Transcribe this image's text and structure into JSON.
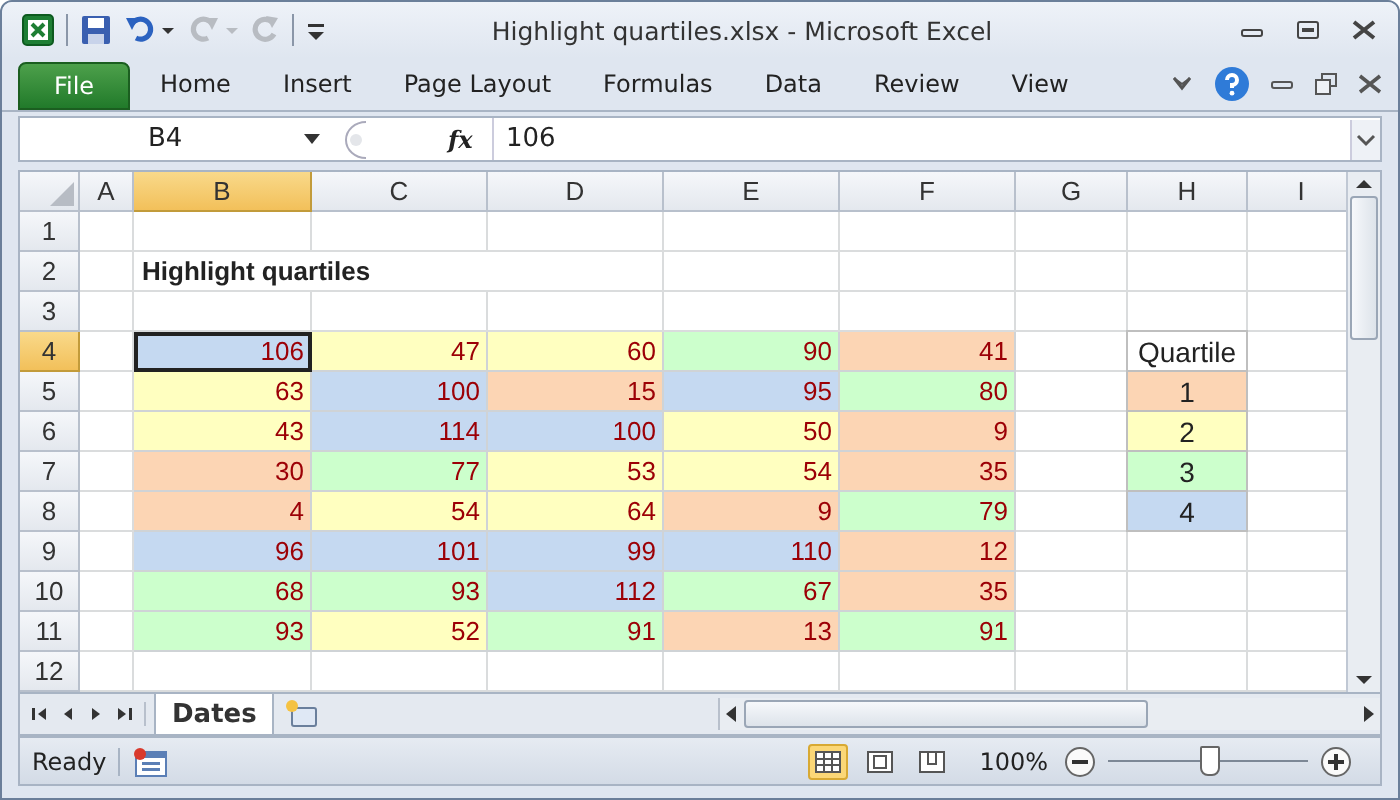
{
  "window": {
    "title": "Highlight quartiles.xlsx  -  Microsoft Excel"
  },
  "ribbon_tabs": [
    {
      "label": "File",
      "kind": "file"
    },
    {
      "label": "Home",
      "kind": "tab"
    },
    {
      "label": "Insert",
      "kind": "tab"
    },
    {
      "label": "Page Layout",
      "kind": "tab"
    },
    {
      "label": "Formulas",
      "kind": "tab"
    },
    {
      "label": "Data",
      "kind": "tab"
    },
    {
      "label": "Review",
      "kind": "tab"
    },
    {
      "label": "View",
      "kind": "tab"
    }
  ],
  "formula_bar": {
    "name_box": "B4",
    "fx": "fx",
    "value": "106"
  },
  "columns": [
    {
      "label": "A",
      "selected": false
    },
    {
      "label": "B",
      "selected": true
    },
    {
      "label": "C",
      "selected": false
    },
    {
      "label": "D",
      "selected": false
    },
    {
      "label": "E",
      "selected": false
    },
    {
      "label": "F",
      "selected": false
    },
    {
      "label": "G",
      "selected": false
    },
    {
      "label": "H",
      "selected": false
    },
    {
      "label": "I",
      "selected": false
    }
  ],
  "rows": [
    {
      "label": "1",
      "selected": false
    },
    {
      "label": "2",
      "selected": false,
      "title": "Highlight quartiles"
    },
    {
      "label": "3",
      "selected": false
    },
    {
      "label": "4",
      "selected": true,
      "cells": [
        {
          "value": "106",
          "color": "#c5d9f1",
          "selected": true
        },
        {
          "value": "47",
          "color": "#ffffc0",
          "selected": false
        },
        {
          "value": "60",
          "color": "#ffffc0",
          "selected": false
        },
        {
          "value": "90",
          "color": "#ccffcc",
          "selected": false
        },
        {
          "value": "41",
          "color": "#fcd5b4",
          "selected": false
        }
      ],
      "legend": {
        "kind": "header",
        "text": "Quartile"
      }
    },
    {
      "label": "5",
      "selected": false,
      "cells": [
        {
          "value": "63",
          "color": "#ffffc0",
          "selected": false
        },
        {
          "value": "100",
          "color": "#c5d9f1",
          "selected": false
        },
        {
          "value": "15",
          "color": "#fcd5b4",
          "selected": false
        },
        {
          "value": "95",
          "color": "#c5d9f1",
          "selected": false
        },
        {
          "value": "80",
          "color": "#ccffcc",
          "selected": false
        }
      ],
      "legend": {
        "kind": "quartile",
        "text": "1",
        "color": "#fcd5b4"
      }
    },
    {
      "label": "6",
      "selected": false,
      "cells": [
        {
          "value": "43",
          "color": "#ffffc0",
          "selected": false
        },
        {
          "value": "114",
          "color": "#c5d9f1",
          "selected": false
        },
        {
          "value": "100",
          "color": "#c5d9f1",
          "selected": false
        },
        {
          "value": "50",
          "color": "#ffffc0",
          "selected": false
        },
        {
          "value": "9",
          "color": "#fcd5b4",
          "selected": false
        }
      ],
      "legend": {
        "kind": "quartile",
        "text": "2",
        "color": "#ffffc0"
      }
    },
    {
      "label": "7",
      "selected": false,
      "cells": [
        {
          "value": "30",
          "color": "#fcd5b4",
          "selected": false
        },
        {
          "value": "77",
          "color": "#ccffcc",
          "selected": false
        },
        {
          "value": "53",
          "color": "#ffffc0",
          "selected": false
        },
        {
          "value": "54",
          "color": "#ffffc0",
          "selected": false
        },
        {
          "value": "35",
          "color": "#fcd5b4",
          "selected": false
        }
      ],
      "legend": {
        "kind": "quartile",
        "text": "3",
        "color": "#ccffcc"
      }
    },
    {
      "label": "8",
      "selected": false,
      "cells": [
        {
          "value": "4",
          "color": "#fcd5b4",
          "selected": false
        },
        {
          "value": "54",
          "color": "#ffffc0",
          "selected": false
        },
        {
          "value": "64",
          "color": "#ffffc0",
          "selected": false
        },
        {
          "value": "9",
          "color": "#fcd5b4",
          "selected": false
        },
        {
          "value": "79",
          "color": "#ccffcc",
          "selected": false
        }
      ],
      "legend": {
        "kind": "quartile",
        "text": "4",
        "color": "#c5d9f1"
      }
    },
    {
      "label": "9",
      "selected": false,
      "cells": [
        {
          "value": "96",
          "color": "#c5d9f1",
          "selected": false
        },
        {
          "value": "101",
          "color": "#c5d9f1",
          "selected": false
        },
        {
          "value": "99",
          "color": "#c5d9f1",
          "selected": false
        },
        {
          "value": "110",
          "color": "#c5d9f1",
          "selected": false
        },
        {
          "value": "12",
          "color": "#fcd5b4",
          "selected": false
        }
      ]
    },
    {
      "label": "10",
      "selected": false,
      "cells": [
        {
          "value": "68",
          "color": "#ccffcc",
          "selected": false
        },
        {
          "value": "93",
          "color": "#ccffcc",
          "selected": false
        },
        {
          "value": "112",
          "color": "#c5d9f1",
          "selected": false
        },
        {
          "value": "67",
          "color": "#ccffcc",
          "selected": false
        },
        {
          "value": "35",
          "color": "#fcd5b4",
          "selected": false
        }
      ]
    },
    {
      "label": "11",
      "selected": false,
      "cells": [
        {
          "value": "93",
          "color": "#ccffcc",
          "selected": false
        },
        {
          "value": "52",
          "color": "#ffffc0",
          "selected": false
        },
        {
          "value": "91",
          "color": "#ccffcc",
          "selected": false
        },
        {
          "value": "13",
          "color": "#fcd5b4",
          "selected": false
        },
        {
          "value": "91",
          "color": "#ccffcc",
          "selected": false
        }
      ]
    },
    {
      "label": "12",
      "selected": false
    }
  ],
  "sheet_tabs": [
    {
      "label": "Dates",
      "selected": true
    }
  ],
  "status_bar": {
    "status": "Ready",
    "zoom": "100%",
    "zoom_slider": {
      "level": 0.5
    },
    "views": [
      {
        "kind": "normal",
        "selected": true
      },
      {
        "kind": "page-layout",
        "selected": false
      },
      {
        "kind": "page-break",
        "selected": false
      }
    ]
  }
}
